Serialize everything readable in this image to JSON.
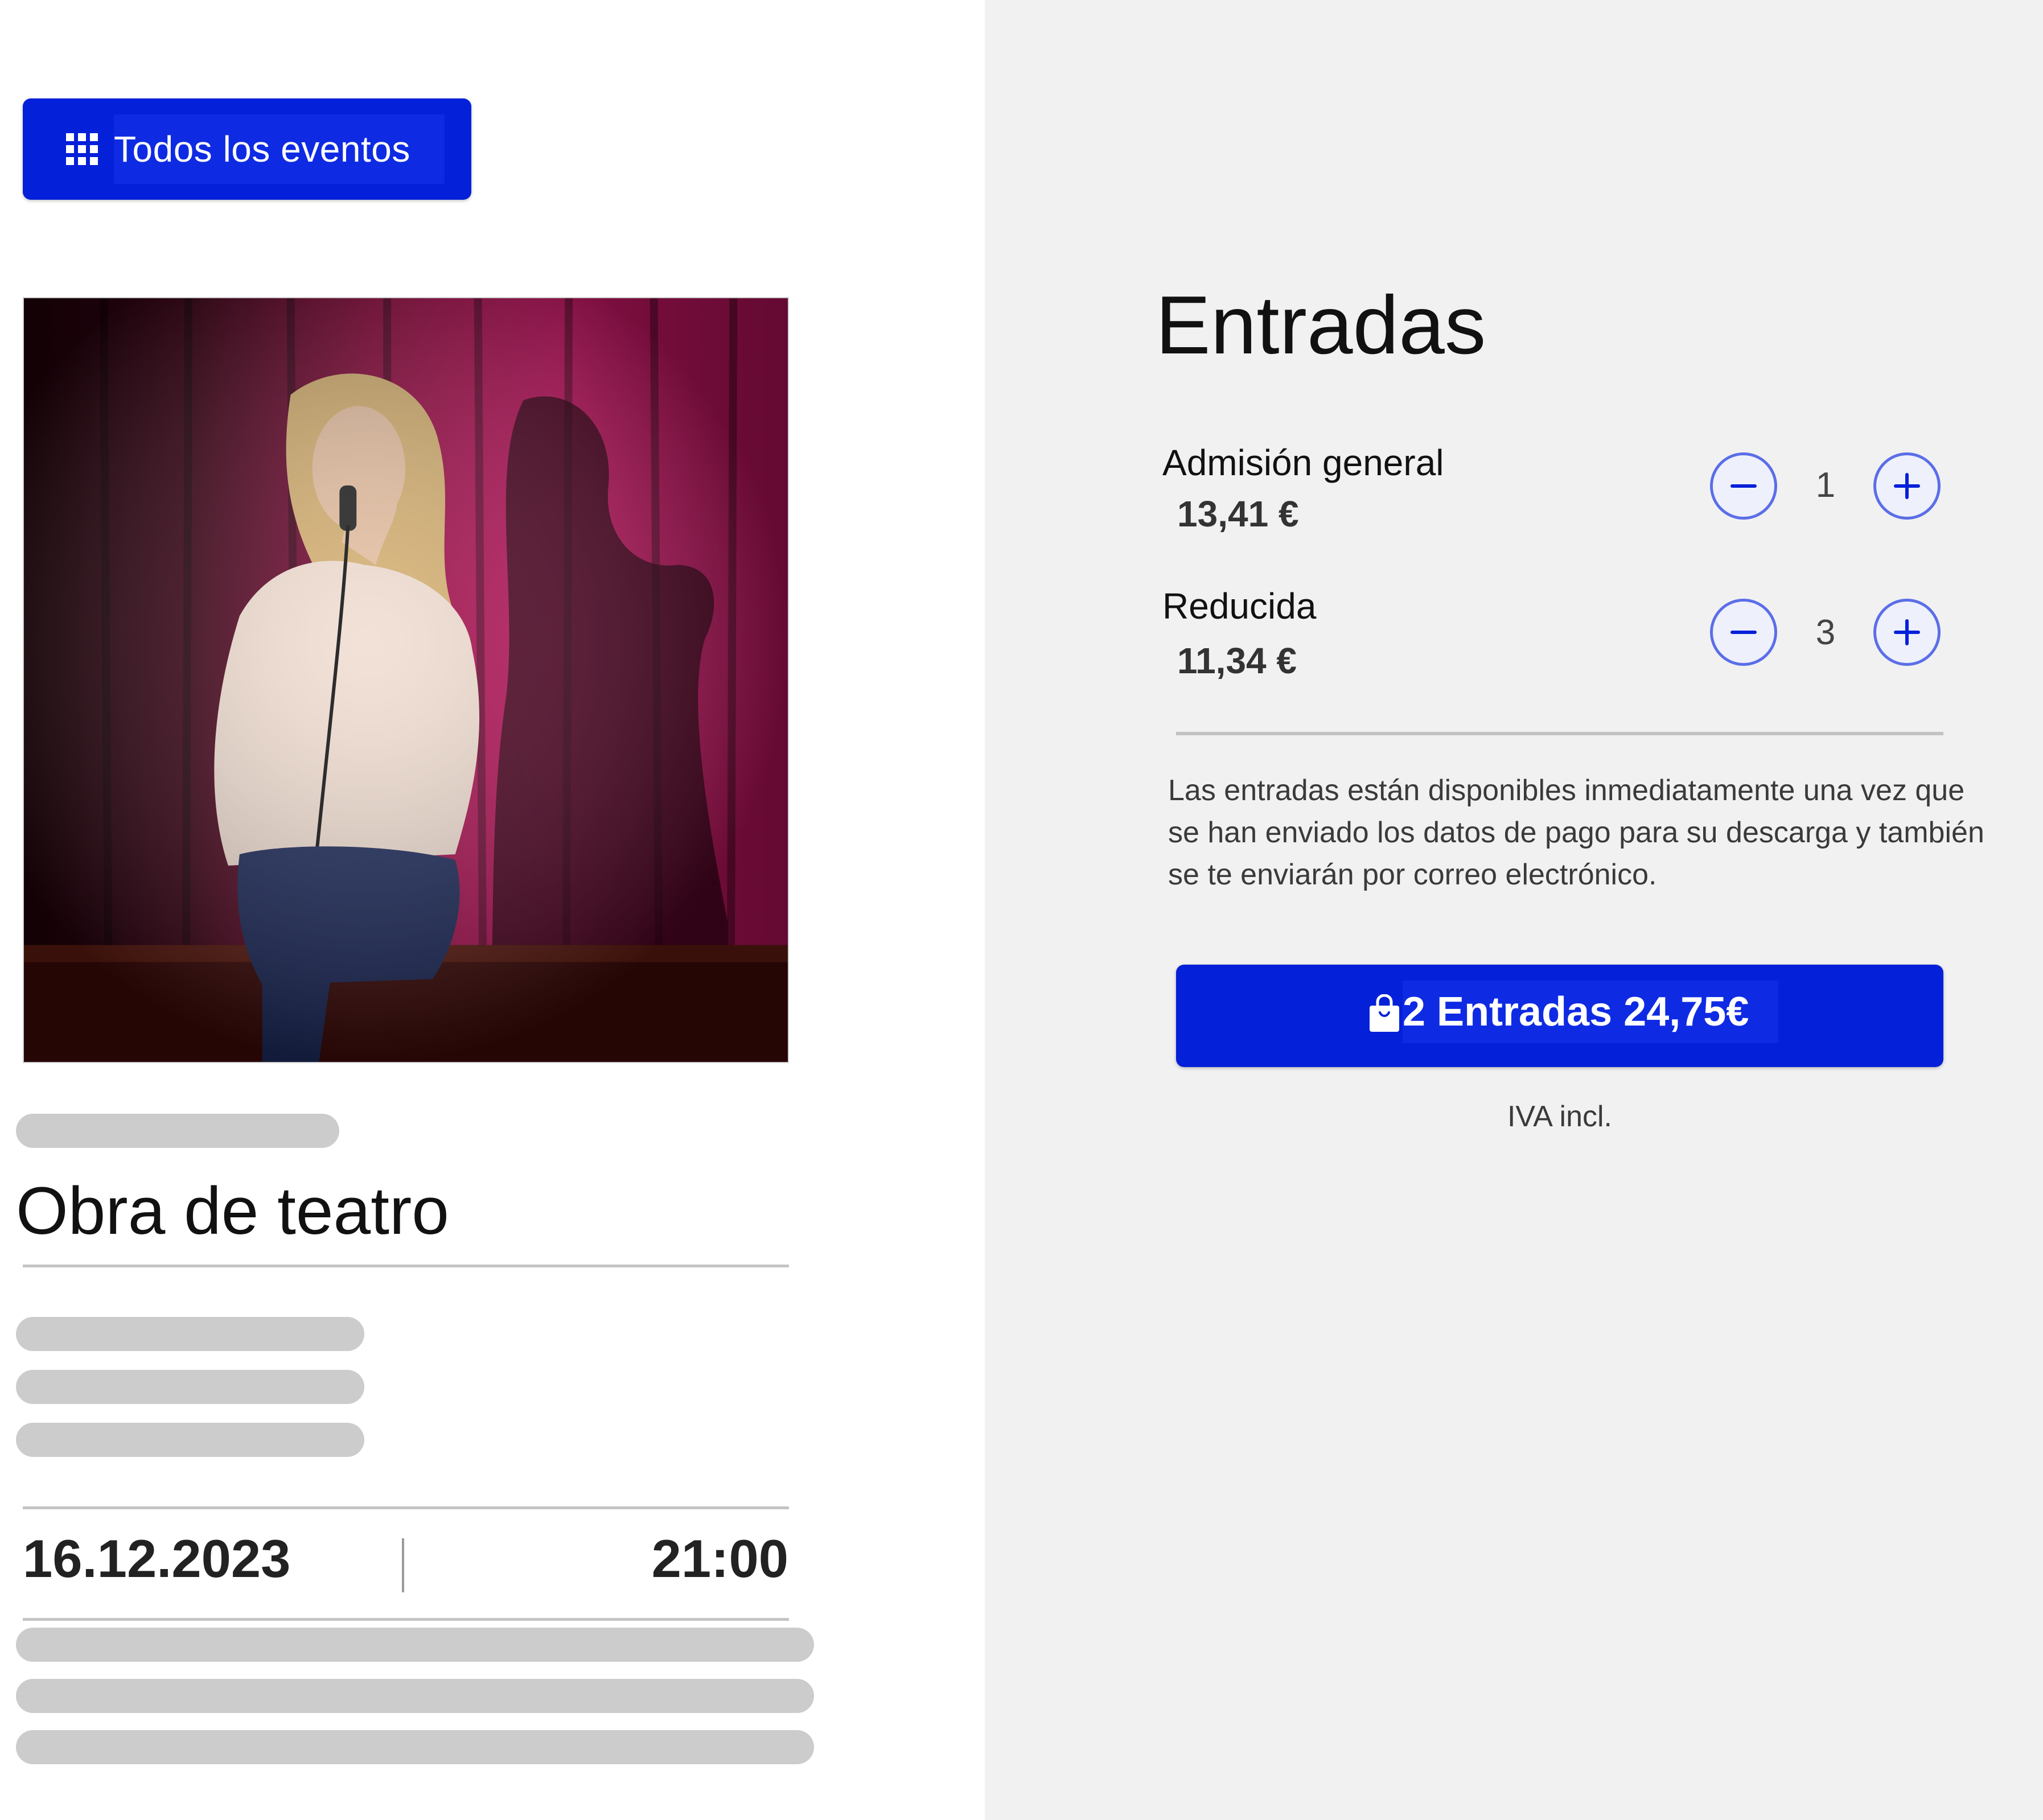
{
  "nav": {
    "all_events_label": "Todos los eventos",
    "all_events_icon": "grid-icon"
  },
  "event": {
    "title": "Obra de teatro",
    "date": "16.12.2023",
    "time": "21:00"
  },
  "tickets": {
    "title": "Entradas",
    "items": [
      {
        "name": "Admisión general",
        "price": "13,41 €",
        "quantity": "1"
      },
      {
        "name": "Reducida",
        "price": "11,34 €",
        "quantity": "3"
      }
    ],
    "info": "Las entradas están disponibles inmediatamente una vez que se han enviado los datos de pago para su descarga y también se te enviarán por correo electrónico.",
    "buy_label": "2 Entradas 24,75€",
    "buy_icon": "shopping-bag-icon",
    "tax_note": "IVA incl."
  },
  "colors": {
    "accent": "#0420d9",
    "panel_bg": "#f1f1f1",
    "skeleton": "#cccccc",
    "stepper_border": "#5b6ee8"
  }
}
